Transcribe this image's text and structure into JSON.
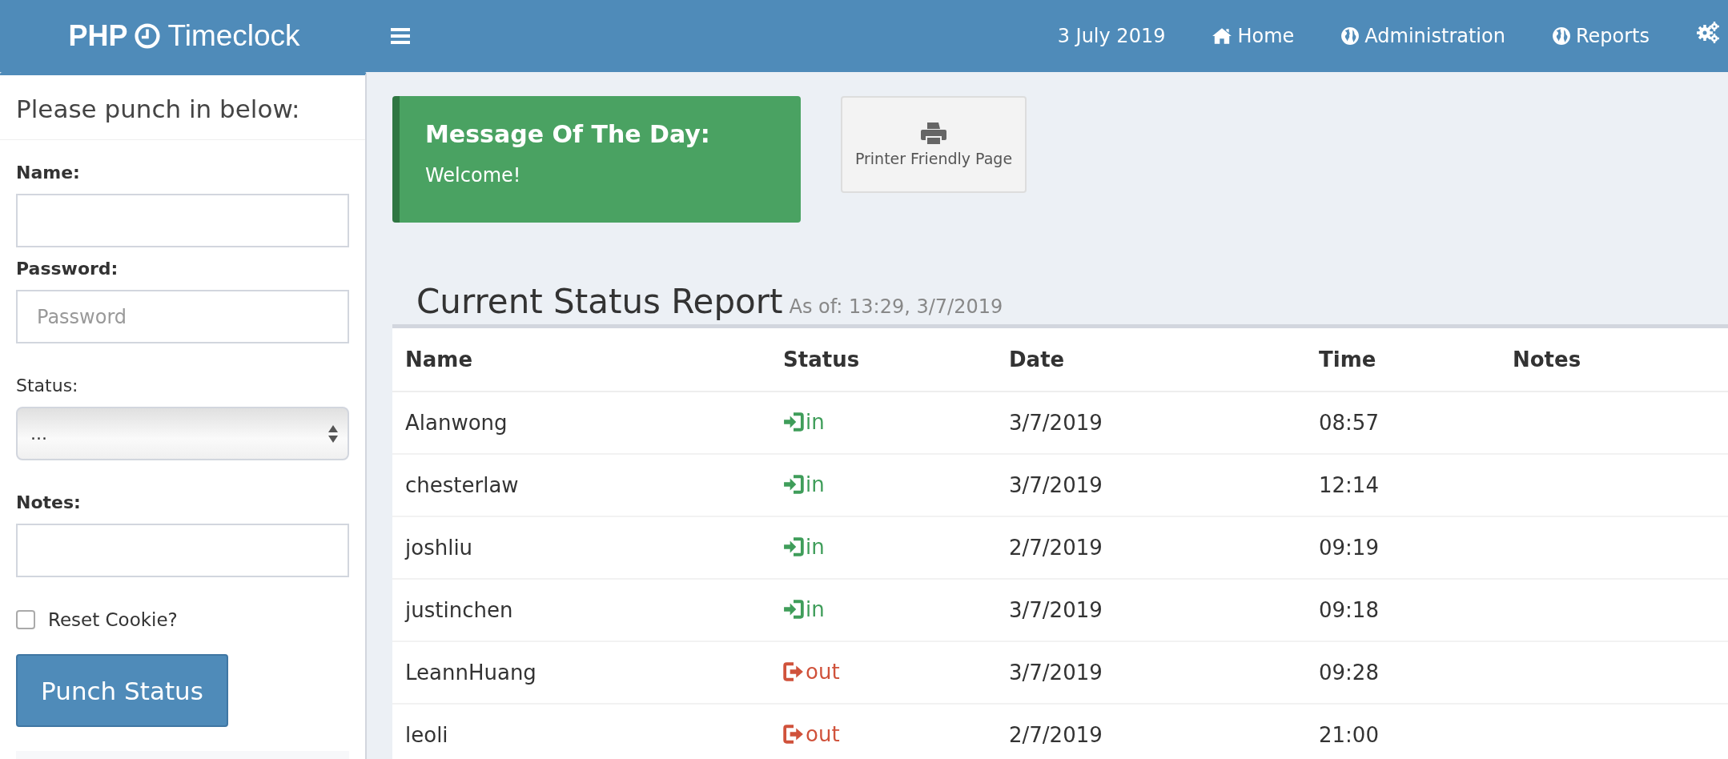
{
  "header": {
    "logo_bold": "PHP",
    "logo_light": "Timeclock",
    "date": "3 July 2019",
    "nav": [
      {
        "label": "Home",
        "kind": "home"
      },
      {
        "label": "Administration",
        "kind": "globe"
      },
      {
        "label": "Reports",
        "kind": "globe"
      }
    ]
  },
  "sidebar": {
    "title": "Please punch in below:",
    "fields": [
      {
        "kind": "text",
        "label": "Name:"
      },
      {
        "kind": "text",
        "label": "Password:",
        "placeholder": "Password"
      },
      {
        "kind": "select",
        "label": "Status:",
        "value": "..."
      },
      {
        "kind": "text",
        "label": "Notes:"
      }
    ],
    "checkbox": {
      "label": "Reset Cookie?",
      "checked": false
    },
    "button": "Punch Status"
  },
  "motd": {
    "title": "Message Of The Day:",
    "text": "Welcome!"
  },
  "print_button": "Printer Friendly Page",
  "report": {
    "title": "Current Status Report",
    "subtitle": "As of: 13:29, 3/7/2019",
    "columns": [
      "Name",
      "Status",
      "Date",
      "Time",
      "Notes"
    ],
    "rows": [
      {
        "name": "Alanwong",
        "status": "in",
        "kind": "in",
        "date": "3/7/2019",
        "time": "08:57"
      },
      {
        "name": "chesterlaw",
        "status": "in",
        "kind": "in",
        "date": "3/7/2019",
        "time": "12:14"
      },
      {
        "name": "joshliu",
        "status": "in",
        "kind": "in",
        "date": "2/7/2019",
        "time": "09:19"
      },
      {
        "name": "justinchen",
        "status": "in",
        "kind": "in",
        "date": "3/7/2019",
        "time": "09:18"
      },
      {
        "name": "LeannHuang",
        "status": "out",
        "kind": "out",
        "date": "3/7/2019",
        "time": "09:28"
      },
      {
        "name": "leoli",
        "status": "out",
        "kind": "out",
        "date": "2/7/2019",
        "time": "21:00"
      }
    ]
  }
}
